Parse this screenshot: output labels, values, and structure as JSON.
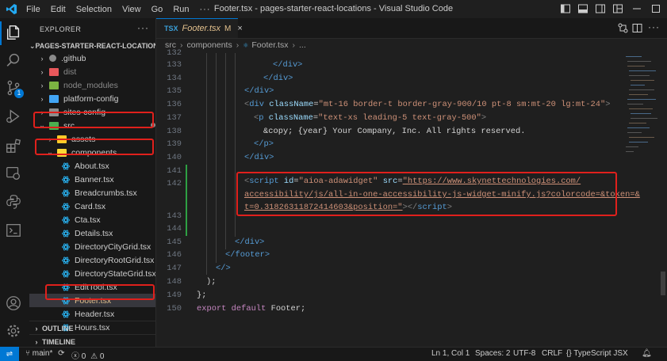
{
  "titlebar": {
    "menu": [
      "File",
      "Edit",
      "Selection",
      "View",
      "Go",
      "Run"
    ],
    "more": "···",
    "title": "Footer.tsx - pages-starter-react-locations - Visual Studio Code"
  },
  "sidebar": {
    "title": "EXPLORER",
    "more": "···",
    "root": "PAGES-STARTER-REACT-LOCATIONS",
    "items": [
      {
        "label": ".github",
        "kind": "folder"
      },
      {
        "label": "dist",
        "kind": "folder"
      },
      {
        "label": "node_modules",
        "kind": "folder"
      },
      {
        "label": "platform-config",
        "kind": "folder"
      },
      {
        "label": "sites-config",
        "kind": "folder"
      },
      {
        "label": "src",
        "kind": "folder-open"
      },
      {
        "label": "assets",
        "kind": "folder"
      },
      {
        "label": "components",
        "kind": "folder-open"
      },
      {
        "label": "About.tsx",
        "kind": "file"
      },
      {
        "label": "Banner.tsx",
        "kind": "file"
      },
      {
        "label": "Breadcrumbs.tsx",
        "kind": "file"
      },
      {
        "label": "Card.tsx",
        "kind": "file"
      },
      {
        "label": "Cta.tsx",
        "kind": "file"
      },
      {
        "label": "Details.tsx",
        "kind": "file"
      },
      {
        "label": "DirectoryCityGrid.tsx",
        "kind": "file"
      },
      {
        "label": "DirectoryRootGrid.tsx",
        "kind": "file"
      },
      {
        "label": "DirectoryStateGrid.tsx",
        "kind": "file"
      },
      {
        "label": "EditTool.tsx",
        "kind": "file"
      },
      {
        "label": "Footer.tsx",
        "kind": "file",
        "badge": "M"
      },
      {
        "label": "Header.tsx",
        "kind": "file"
      },
      {
        "label": "Hours.tsx",
        "kind": "file"
      }
    ],
    "outline": "OUTLINE",
    "timeline": "TIMELINE"
  },
  "editor": {
    "tab": {
      "icon": "TSX",
      "name": "Footer.tsx",
      "badge": "M",
      "close": "×"
    },
    "breadcrumb": [
      "src",
      "components",
      "Footer.tsx",
      "..."
    ],
    "lines": [
      {
        "n": "132",
        "parts": []
      },
      {
        "n": "133",
        "parts": []
      },
      {
        "n": "134",
        "parts": []
      },
      {
        "n": "135",
        "parts": []
      },
      {
        "n": "136",
        "parts": []
      },
      {
        "n": "137",
        "parts": []
      },
      {
        "n": "138",
        "parts": []
      },
      {
        "n": "139",
        "parts": []
      },
      {
        "n": "140",
        "parts": []
      },
      {
        "n": "141",
        "parts": []
      },
      {
        "n": "142",
        "parts": []
      },
      {
        "n": "143",
        "parts": []
      },
      {
        "n": "144",
        "parts": []
      },
      {
        "n": "145",
        "parts": []
      },
      {
        "n": "146",
        "parts": []
      },
      {
        "n": "147",
        "parts": []
      },
      {
        "n": "148",
        "parts": []
      },
      {
        "n": "149",
        "parts": []
      },
      {
        "n": "150",
        "parts": []
      }
    ],
    "code": {
      "l133": "</div>",
      "l134": "</div>",
      "l135": "</div>",
      "l136a": "div",
      "l136b": "className",
      "l136c": "\"mt-16 border-t border-gray-900/10 pt-8 sm:mt-20 lg:mt-24\"",
      "l137a": "p",
      "l137b": "className",
      "l137c": "\"text-xs leading-5 text-gray-500\"",
      "l138": "&copy; {year} Your Company, Inc. All rights reserved.",
      "l139": "</p>",
      "l140": "</div>",
      "s1a": "script",
      "s1b": "id",
      "s1c": "\"aioa-adawidget\"",
      "s1d": "src",
      "s1e": "\"https://www.skynettechnologies.com/",
      "s2": "accessibility/js/all-in-one-accessibility-js-widget-minify.js?colorcode=&token=&",
      "s3a": "t=0.31826311872414603&position=\"",
      "s3b": "script",
      "l145": "</div>",
      "l146": "</footer>",
      "l147": "</>",
      "l148": ");",
      "l149": "};",
      "l151a": "export",
      "l151b": "default",
      "l151c": "Footer;"
    }
  },
  "statusbar": {
    "branch": "main*",
    "errors": "0",
    "warnings": "0",
    "position": "Ln 1, Col 1",
    "spaces": "Spaces: 2",
    "encoding": "UTF-8",
    "eol": "CRLF",
    "language": "TypeScript JSX"
  }
}
